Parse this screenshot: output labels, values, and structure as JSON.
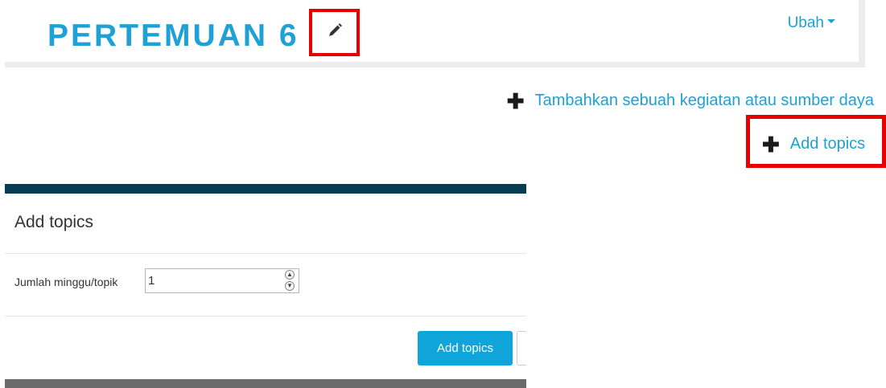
{
  "section": {
    "title": "PERTEMUAN 6",
    "edit_menu_label": "Ubah",
    "edit_title_icon": "pencil-icon"
  },
  "actions": {
    "add_activity_label": "Tambahkan sebuah kegiatan atau sumber daya",
    "add_topics_label": "Add topics",
    "plus_icon": "plus-icon"
  },
  "dialog": {
    "title": "Add topics",
    "field_label": "Jumlah minggu/topik",
    "field_value": "1",
    "submit_label": "Add topics"
  },
  "colors": {
    "accent": "#1fa1d6",
    "highlight": "#e60000",
    "dialog_header": "#063d52",
    "primary_button": "#0fa5da"
  }
}
